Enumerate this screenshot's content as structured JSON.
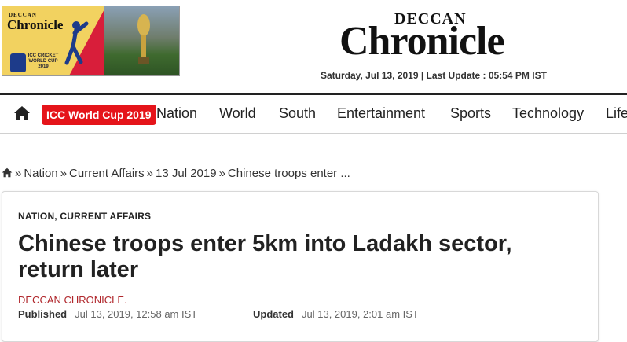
{
  "banner": {
    "logo_small": "DECCAN",
    "logo_big": "Chronicle",
    "cwc_text": "ICC CRICKET WORLD CUP 2019"
  },
  "masthead": {
    "deccan": "DECCAN",
    "chronicle": "Chronicle"
  },
  "dateline": "Saturday, Jul 13, 2019 | Last Update : 05:54 PM IST",
  "nav": {
    "home_icon": "home-icon",
    "highlight": "ICC World Cup 2019",
    "highlight_color": "#e5141a",
    "items": [
      "Nation",
      "World",
      "South",
      "Entertainment",
      "Sports",
      "Technology",
      "Life"
    ]
  },
  "breadcrumb": {
    "items": [
      "Nation",
      "Current Affairs",
      "13 Jul 2019",
      "Chinese troops enter ..."
    ]
  },
  "article": {
    "category": "NATION, CURRENT AFFAIRS",
    "headline": "Chinese troops enter 5km into Ladakh sector, return later",
    "byline": "DECCAN CHRONICLE.",
    "byline_color": "#b0262b",
    "published_label": "Published",
    "published_value": "Jul 13, 2019, 12:58 am IST",
    "updated_label": "Updated",
    "updated_value": "Jul 13, 2019, 2:01 am IST"
  }
}
